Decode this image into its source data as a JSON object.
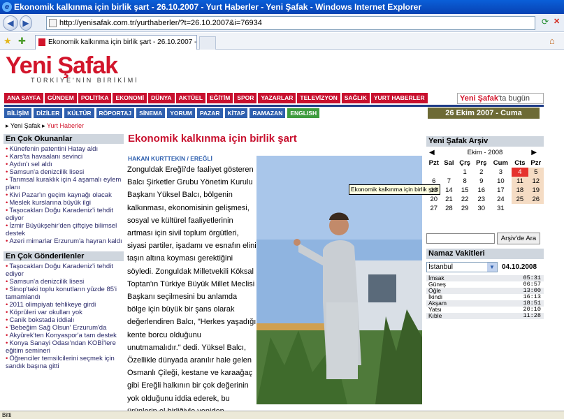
{
  "window": {
    "title": "Ekonomik kalkınma için birlik şart - 26.10.2007 - Yurt Haberler - Yeni Şafak - Windows Internet Explorer"
  },
  "browser": {
    "address": "http://yenisafak.com.tr/yurthaberler/?t=26.10.2007&i=76934",
    "tab_title": "Ekonomik kalkınma için birlik şart - 26.10.2007 - Yurt H...",
    "status": "Bitti"
  },
  "site": {
    "logo_text": "Yeni Şafak",
    "tagline": "TÜRKİYE'NİN BİRİKİMİ",
    "brand_color": "#d2152b",
    "bugun_brand": "Yeni Şafak",
    "bugun_suffix": "'ta bugün",
    "date": "26 Ekim 2007 - Cuma"
  },
  "main_nav": [
    "ANA SAYFA",
    "GÜNDEM",
    "POLİTİKA",
    "EKONOMİ",
    "DÜNYA",
    "AKTÜEL",
    "EĞİTİM",
    "SPOR",
    "YAZARLAR",
    "TELEVİZYON",
    "SAĞLIK",
    "YURT HABERLER"
  ],
  "sub_nav": [
    "BİLİŞİM",
    "DİZİLER",
    "KÜLTÜR",
    "RÖPORTAJ",
    "SİNEMA",
    "YORUM",
    "PAZAR",
    "KİTAP",
    "RAMAZAN",
    "ENGLISH"
  ],
  "breadcrumb": {
    "home": "Yeni Şafak",
    "current": "Yurt Haberler"
  },
  "most_read": {
    "title": "En Çok Okunanlar",
    "items": [
      "Künefenin patentini Hatay aldı",
      "Kars'ta havaalanı sevinci",
      "Aydın'ı sel aldı",
      "Samsun'a denizcilik lisesi",
      "Tarımsal kuraklık için 4 aşamalı eylem planı",
      "Kivi Pazar'ın geçim kaynağı olacak",
      "Meslek kurslarına büyük ilgi",
      "Taşocakları Doğu Karadeniz'i tehdit ediyor",
      "İzmir Büyükşehir'den çiftçiye bilimsel destek",
      "Azeri mimarlar Erzurum'a hayran kaldı"
    ]
  },
  "most_sent": {
    "title": "En Çok Gönderilenler",
    "items": [
      "Taşocakları Doğu Karadeniz'i tehdit ediyor",
      "Samsun'a denizcilik lisesi",
      "Sinop'taki toplu konutların yüzde 85'i tamamlandı",
      "2011 olimpiyatı tehlikeye girdi",
      "Köprüleri var okulları yok",
      "Canik bokstada iddialı",
      "'Bebeğim Sağ Olsun' Erzurum'da",
      "Akyürek'ten Konyaspor'a tam destek",
      "Konya Sanayi Odası'ndan KOBİ'lere eğitim semineri",
      "Öğrenciler temsilcilerini seçmek için sandık başına gitti"
    ]
  },
  "article": {
    "title": "Ekonomik kalkınma için birlik şart",
    "byline": "HAKAN KURTTEKİN / EREĞLİ",
    "body": "Zonguldak Ereğli'de faaliyet gösteren Balcı Şirketler Grubu Yönetim Kurulu Başkanı Yüksel Balcı, bölgenin kalkınması, ekonomisinin gelişmesi, sosyal ve kültürel faaliyetlerinin artması için sivil toplum örgütleri, siyasi partiler, işadamı ve esnafın elini taşın altına koyması gerektiğini söyledi. Zonguldak Milletvekili Köksal Toptan'ın Türkiye Büyük Millet Meclisi Başkanı seçilmesini bu anlamda bölge için büyük bir şans olarak değerlendiren Balcı, \"Herkes yaşadığı kente borcu olduğunu unutmamalıdır.\" dedi. Yüksel Balcı, Özellikle dünyada aranılır hale gelen Osmanlı Çileği, kestane ve karaağaç gibi Ereğli halkının bir çok değerinin yok olduğunu iddia ederek, bu ürünlerin el birliğiyle yeniden ekonomiye kazandırılması gerektiğini söyledi.",
    "tooltip": "Ekonomik kalkınma için birlik şart"
  },
  "archive": {
    "title": "Yeni Şafak Arşiv",
    "month": "Ekim - 2008",
    "weekdays": [
      "Pzt",
      "Sal",
      "Çrş",
      "Prş",
      "Cum",
      "Cts",
      "Pzr"
    ],
    "weeks": [
      [
        "",
        "",
        "1",
        "2",
        "3",
        "4",
        "5"
      ],
      [
        "6",
        "7",
        "8",
        "9",
        "10",
        "11",
        "12"
      ],
      [
        "13",
        "14",
        "15",
        "16",
        "17",
        "18",
        "19"
      ],
      [
        "20",
        "21",
        "22",
        "23",
        "24",
        "25",
        "26"
      ],
      [
        "27",
        "28",
        "29",
        "30",
        "31",
        "",
        ""
      ]
    ],
    "today": "4",
    "search_button": "Arşiv'de Ara"
  },
  "prayer": {
    "title": "Namaz Vakitleri",
    "city": "İstanbul",
    "date": "04.10.2008",
    "times": [
      {
        "name": "İmsak",
        "time": "05:31"
      },
      {
        "name": "Güneş",
        "time": "06:57"
      },
      {
        "name": "Öğle",
        "time": "13:00"
      },
      {
        "name": "İkindi",
        "time": "16:13"
      },
      {
        "name": "Akşam",
        "time": "18:51"
      },
      {
        "name": "Yatsı",
        "time": "20:10"
      },
      {
        "name": "Kıble",
        "time": "11:28"
      }
    ]
  }
}
